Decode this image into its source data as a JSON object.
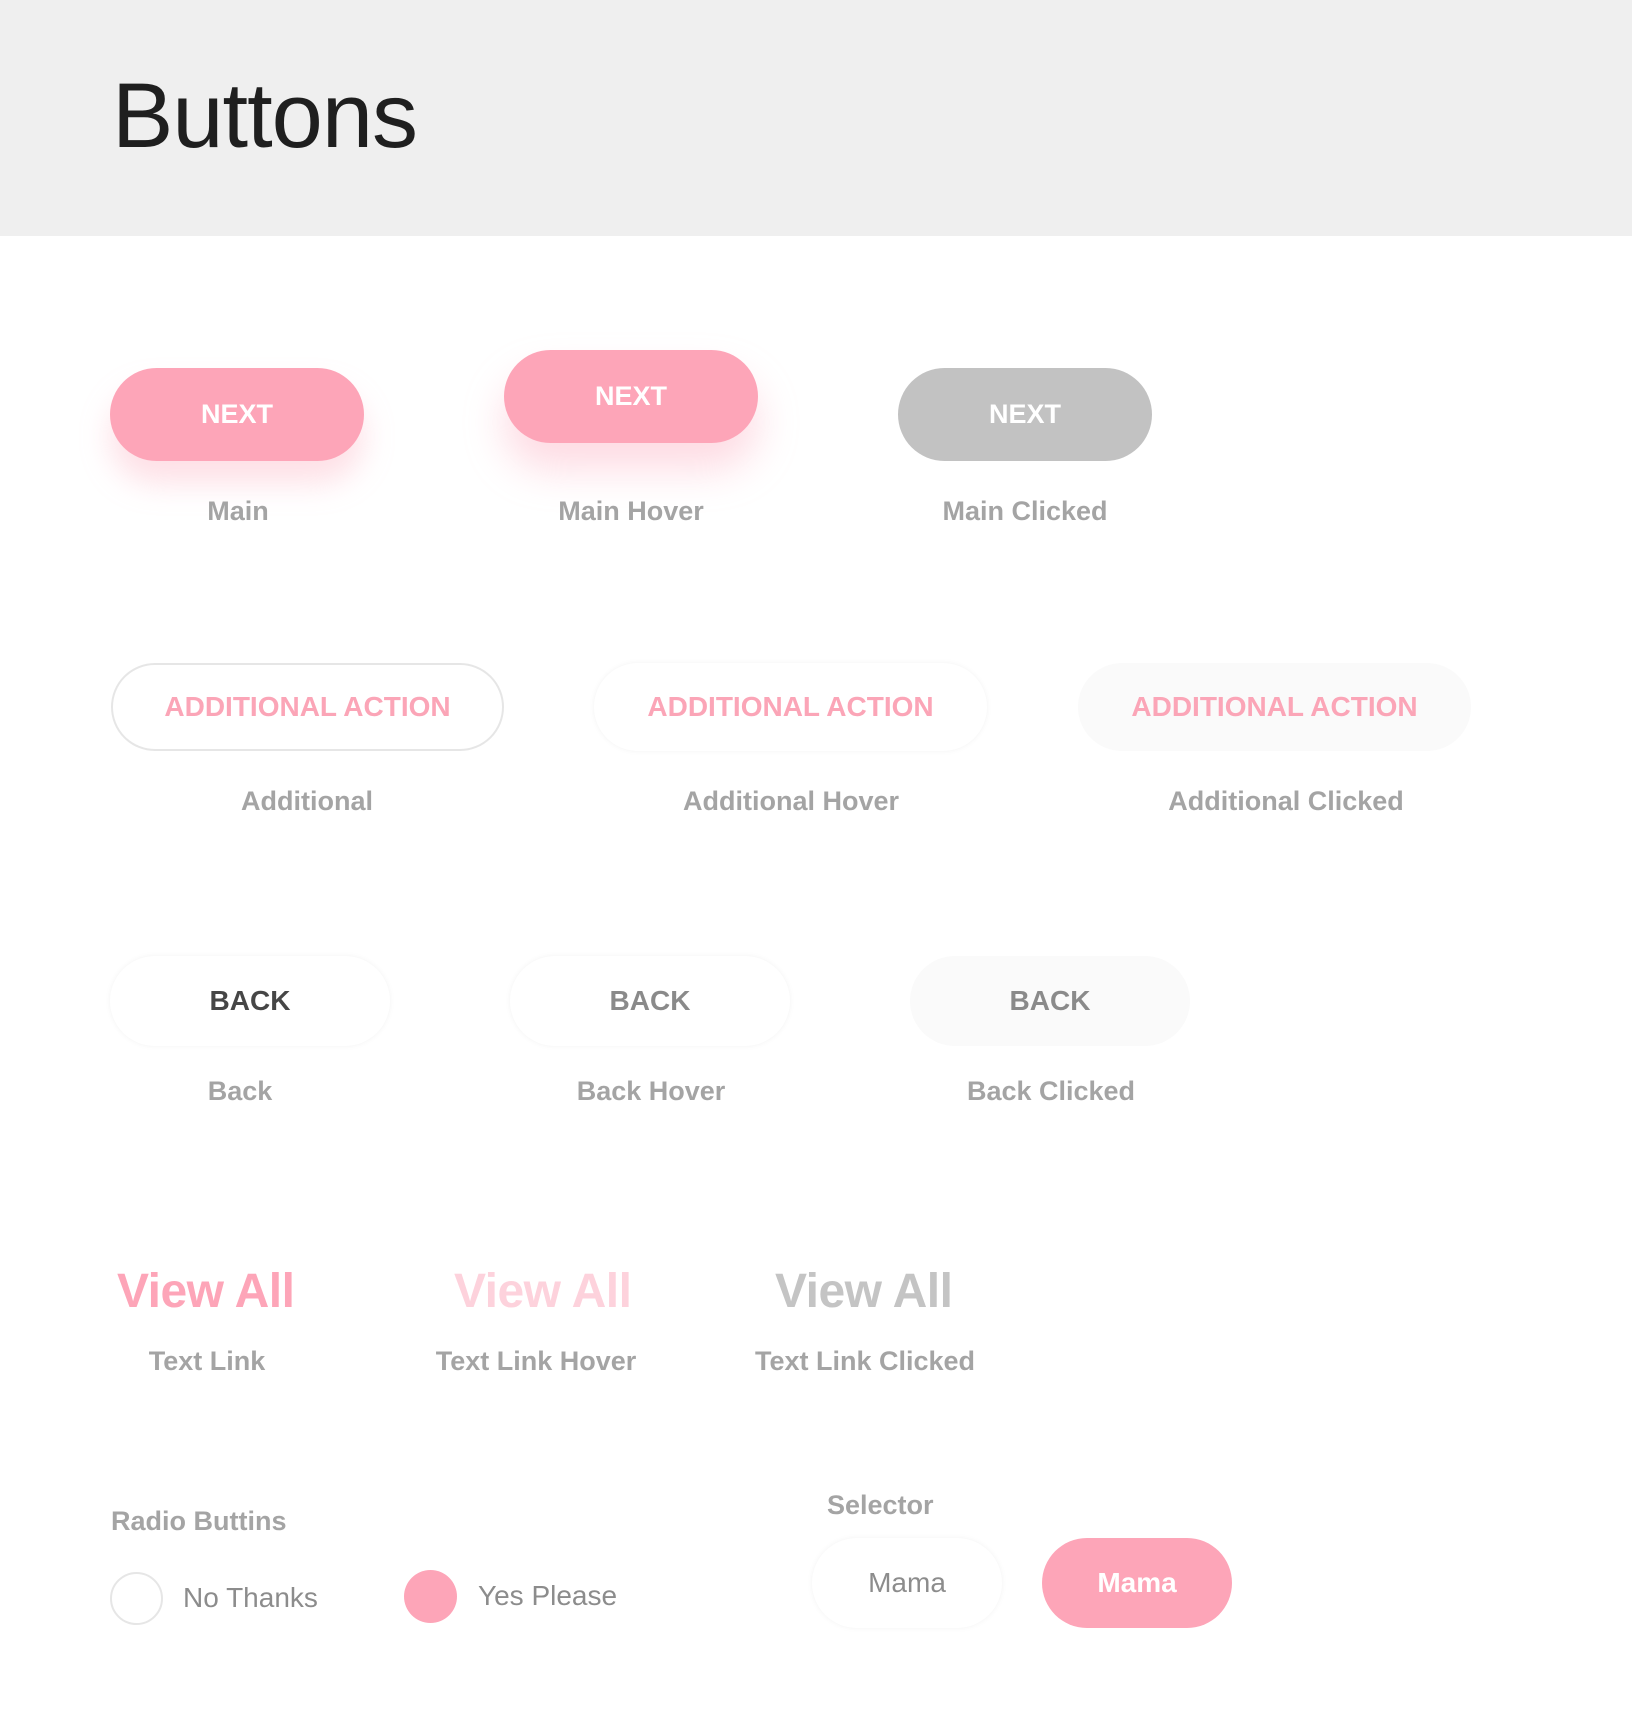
{
  "header": {
    "title": "Buttons"
  },
  "colors": {
    "accent_pink": "#fda5b8",
    "accent_pink_light": "#fdd2dc",
    "clicked_gray": "#c2c2c2",
    "header_bg": "#efefef",
    "caption_gray": "#a4a4a4"
  },
  "main_buttons": [
    {
      "label": "NEXT",
      "caption": "Main",
      "state": "default"
    },
    {
      "label": "NEXT",
      "caption": "Main Hover",
      "state": "hover"
    },
    {
      "label": "NEXT",
      "caption": "Main Clicked",
      "state": "clicked"
    }
  ],
  "additional_buttons": [
    {
      "label": "ADDITIONAL ACTION",
      "caption": "Additional",
      "state": "default"
    },
    {
      "label": "ADDITIONAL ACTION",
      "caption": "Additional Hover",
      "state": "hover"
    },
    {
      "label": "ADDITIONAL ACTION",
      "caption": "Additional Clicked",
      "state": "clicked"
    }
  ],
  "back_buttons": [
    {
      "label": "BACK",
      "caption": "Back",
      "state": "default"
    },
    {
      "label": "BACK",
      "caption": "Back Hover",
      "state": "hover"
    },
    {
      "label": "BACK",
      "caption": "Back Clicked",
      "state": "clicked"
    }
  ],
  "text_links": [
    {
      "label": "View All",
      "caption": "Text Link",
      "state": "default"
    },
    {
      "label": "View All",
      "caption": "Text Link Hover",
      "state": "hover"
    },
    {
      "label": "View All",
      "caption": "Text Link Clicked",
      "state": "clicked"
    }
  ],
  "radio": {
    "heading": "Radio Buttins",
    "options": [
      {
        "label": "No Thanks",
        "selected": false
      },
      {
        "label": "Yes Please",
        "selected": true
      }
    ]
  },
  "selector": {
    "heading": "Selector",
    "options": [
      {
        "label": "Mama",
        "selected": false
      },
      {
        "label": "Mama",
        "selected": true
      }
    ]
  }
}
